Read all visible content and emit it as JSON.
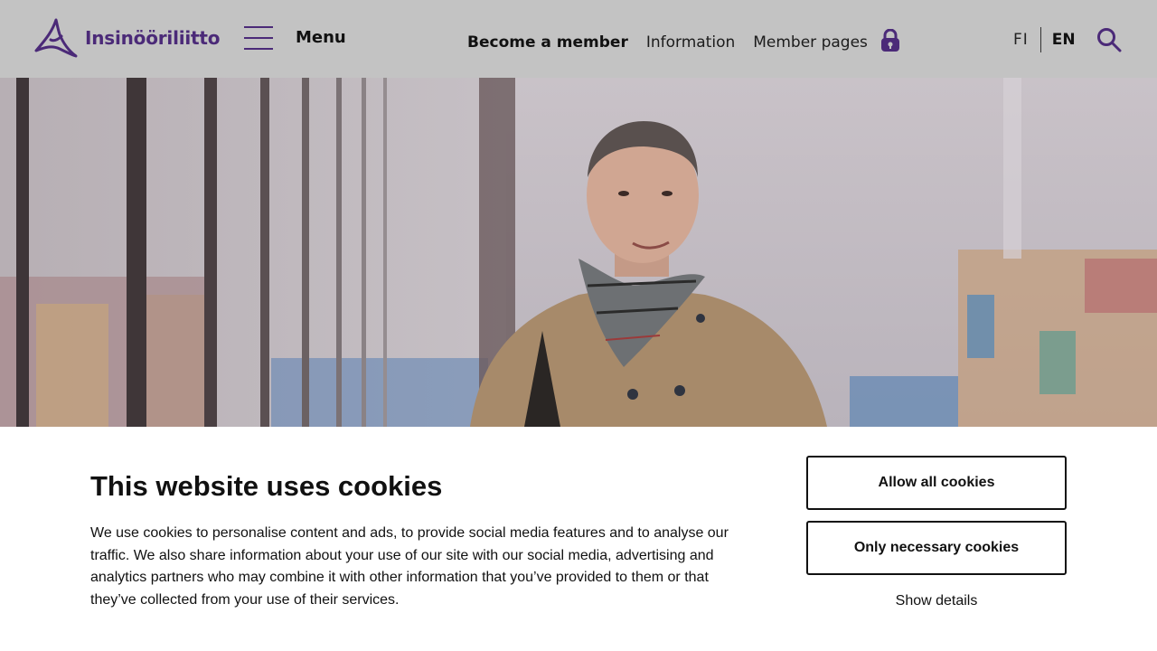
{
  "header": {
    "logo_text": "Insinööriliitto",
    "menu_label": "Menu",
    "nav": {
      "become_member": "Become a member",
      "information": "Information",
      "member_pages": "Member pages"
    },
    "lang": {
      "fi": "FI",
      "en": "EN"
    },
    "icons": [
      "logo-mark-icon",
      "hamburger-icon",
      "lock-icon",
      "search-icon"
    ],
    "accent_color": "#4b2a78",
    "background_color": "#c3c3c3"
  },
  "cookie_banner": {
    "title": "This website uses cookies",
    "text": "We use cookies to personalise content and ads, to provide social media features and to analyse our traffic. We also share information about your use of our site with our social media, advertising and analytics partners who may combine it with other information that you’ve provided to them or that they’ve collected from your use of their services.",
    "allow_all": "Allow all cookies",
    "only_necessary": "Only necessary cookies",
    "show_details": "Show details"
  }
}
